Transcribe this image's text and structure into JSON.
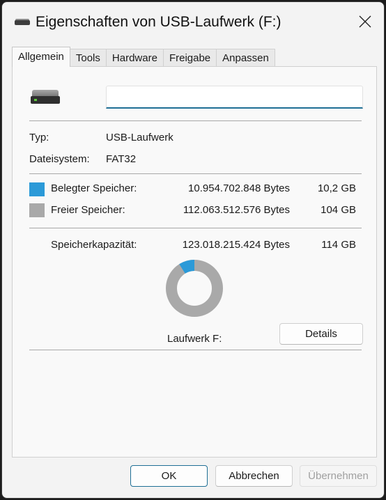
{
  "window": {
    "title": "Eigenschaften von USB-Laufwerk (F:)",
    "close_icon": "close-icon"
  },
  "tabs": [
    {
      "label": "Allgemein",
      "active": true
    },
    {
      "label": "Tools",
      "active": false
    },
    {
      "label": "Hardware",
      "active": false
    },
    {
      "label": "Freigabe",
      "active": false
    },
    {
      "label": "Anpassen",
      "active": false
    }
  ],
  "general": {
    "drive_icon": "usb-drive-icon",
    "name_value": "",
    "type_label": "Typ:",
    "type_value": "USB-Laufwerk",
    "fs_label": "Dateisystem:",
    "fs_value": "FAT32",
    "used": {
      "label": "Belegter Speicher:",
      "bytes": "10.954.702.848 Bytes",
      "size": "10,2 GB",
      "color": "#2b9ad8"
    },
    "free": {
      "label": "Freier Speicher:",
      "bytes": "112.063.512.576 Bytes",
      "size": "104 GB",
      "color": "#a9a9a9"
    },
    "capacity": {
      "label": "Speicherkapazität:",
      "bytes": "123.018.215.424 Bytes",
      "size": "114 GB"
    },
    "used_fraction": 0.089,
    "drive_label": "Laufwerk F:",
    "details_button": "Details"
  },
  "footer": {
    "ok": "OK",
    "cancel": "Abbrechen",
    "apply": "Übernehmen"
  }
}
